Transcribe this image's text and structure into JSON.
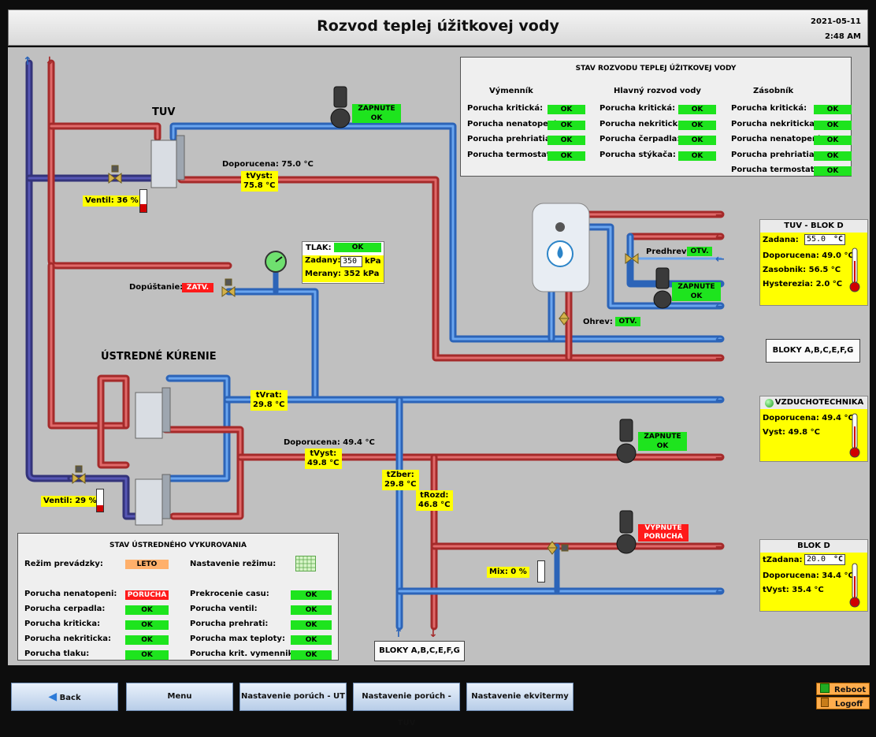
{
  "header": {
    "title": "Rozvod teplej úžitkovej vody",
    "date": "2021-05-11",
    "time": "2:48 AM"
  },
  "tuv_title": "TUV",
  "ut_title": "ÚSTREDNÉ KÚRENIE",
  "pump_status": {
    "tuv_pump": {
      "line1": "ZAPNUTE",
      "line2": "OK"
    },
    "boiler_pump": {
      "line1": "ZAPNUTE",
      "line2": "OK"
    },
    "ut_pump": {
      "line1": "ZAPNUTE",
      "line2": "OK"
    },
    "blokd_pump": {
      "line1": "VYPNUTE",
      "line2": "PORUCHA"
    }
  },
  "tuv": {
    "doporucena": "Doporucena: 75.0 °C",
    "tvyst_label": "tVyst:",
    "tvyst_value": "75.8 °C",
    "ventil": "Ventil: 36 %",
    "ventil_level": 0.36
  },
  "doplnanie": {
    "label": "Dopúštanie:",
    "status": "ZATV."
  },
  "tlak": {
    "label": "TLAK:",
    "status": "OK",
    "zadany_label": "Zadany:",
    "zadany_value": "350",
    "unit": "kPa",
    "merany": "Merany: 352 kPa"
  },
  "ut": {
    "tvrat_label": "tVrat:",
    "tvrat_value": "29.8 °C",
    "doporucena": "Doporucena: 49.4 °C",
    "tvyst_label": "tVyst:",
    "tvyst_value": "49.8 °C",
    "ventil": "Ventil: 29 %",
    "ventil_level": 0.29,
    "tzber_label": "tZber:",
    "tzber_value": "29.8 °C",
    "trozd_label": "tRozd:",
    "trozd_value": "46.8 °C",
    "mix": "Mix: 0 %",
    "mix_level": 0
  },
  "boiler": {
    "predhrev_label": "Predhrev:",
    "predhrev_status": "OTV.",
    "ohrev_label": "Ohrev:",
    "ohrev_status": "OTV."
  },
  "stav_tuv": {
    "title": "STAV ROZVODU TEPLEJ ÚŽITKOVEJ VODY",
    "columns": [
      {
        "header": "Výmenník",
        "rows": [
          {
            "label": "Porucha kritická:",
            "status": "OK"
          },
          {
            "label": "Porucha nenatopeni:",
            "status": "OK"
          },
          {
            "label": "Porucha prehriatia:",
            "status": "OK"
          },
          {
            "label": "Porucha termostat:",
            "status": "OK"
          }
        ]
      },
      {
        "header": "Hlavný rozvod vody",
        "rows": [
          {
            "label": "Porucha kritická:",
            "status": "OK"
          },
          {
            "label": "Porucha nekriticka:",
            "status": "OK"
          },
          {
            "label": "Porucha čerpadla:",
            "status": "OK"
          },
          {
            "label": "Porucha stýkača:",
            "status": "OK"
          }
        ]
      },
      {
        "header": "Zásobník",
        "rows": [
          {
            "label": "Porucha kritická:",
            "status": "OK"
          },
          {
            "label": "Porucha nekriticka:",
            "status": "OK"
          },
          {
            "label": "Porucha nenatopeni:",
            "status": "OK"
          },
          {
            "label": "Porucha prehriatia:",
            "status": "OK"
          },
          {
            "label": "Porucha termostat:",
            "status": "OK"
          }
        ]
      }
    ]
  },
  "tuv_blokd": {
    "title": "TUV - BLOK D",
    "zadana_label": "Zadana:",
    "zadana_value": "55.0",
    "unit": "°C",
    "doporucena": "Doporucena: 49.0 °C",
    "zasobnik": "Zasobnik: 56.5 °C",
    "hysterezia": "Hysterezia: 2.0 °C"
  },
  "bloky_right": "BLOKY A,B,C,E,F,G",
  "bloky_bottom": "BLOKY A,B,C,E,F,G",
  "vzt": {
    "title": "VZDUCHOTECHNIKA",
    "doporucena": "Doporucena: 49.4 °C",
    "vyst": "Vyst: 49.8 °C"
  },
  "blokd": {
    "title": "BLOK D",
    "tzadana_label": "tZadana:",
    "tzadana_value": "20.0",
    "unit": "°C",
    "doporucena": "Doporucena: 34.4 °C",
    "tvyst": "tVyst: 35.4 °C"
  },
  "stav_ut": {
    "title": "STAV ÚSTREDNÉHO VYKUROVANIA",
    "rezim_label": "Režim prevádzky:",
    "rezim_value": "LETO",
    "nastavenie_label": "Nastavenie režimu:",
    "left": [
      {
        "label": "Porucha nenatopeni:",
        "status": "PORUCHA",
        "alarm": true
      },
      {
        "label": "Porucha cerpadla:",
        "status": "OK",
        "alarm": false
      },
      {
        "label": "Porucha kriticka:",
        "status": "OK",
        "alarm": false
      },
      {
        "label": "Porucha nekriticka:",
        "status": "OK",
        "alarm": false
      },
      {
        "label": "Porucha tlaku:",
        "status": "OK",
        "alarm": false
      }
    ],
    "right": [
      {
        "label": "Prekrocenie casu:",
        "status": "OK"
      },
      {
        "label": "Porucha ventil:",
        "status": "OK"
      },
      {
        "label": "Porucha prehrati:",
        "status": "OK"
      },
      {
        "label": "Porucha max teploty:",
        "status": "OK"
      },
      {
        "label": "Porucha krit. vymennik:",
        "status": "OK"
      }
    ]
  },
  "nav": {
    "back": "Back",
    "menu": "Menu",
    "ut": "Nastavenie porúch - UT",
    "tuv": "Nastavenie porúch - TUV",
    "ekviterm": "Nastavenie ekvitermy",
    "reboot": "Reboot",
    "logoff": "Logoff"
  },
  "colors": {
    "ok": "#1ee41e",
    "alarm": "#ff1a1a",
    "hot_pipe": "#d23a3a",
    "cold_pipe": "#3a7fd5",
    "return_pipe": "#3b3b8f",
    "label_bg": "#ffff00"
  }
}
